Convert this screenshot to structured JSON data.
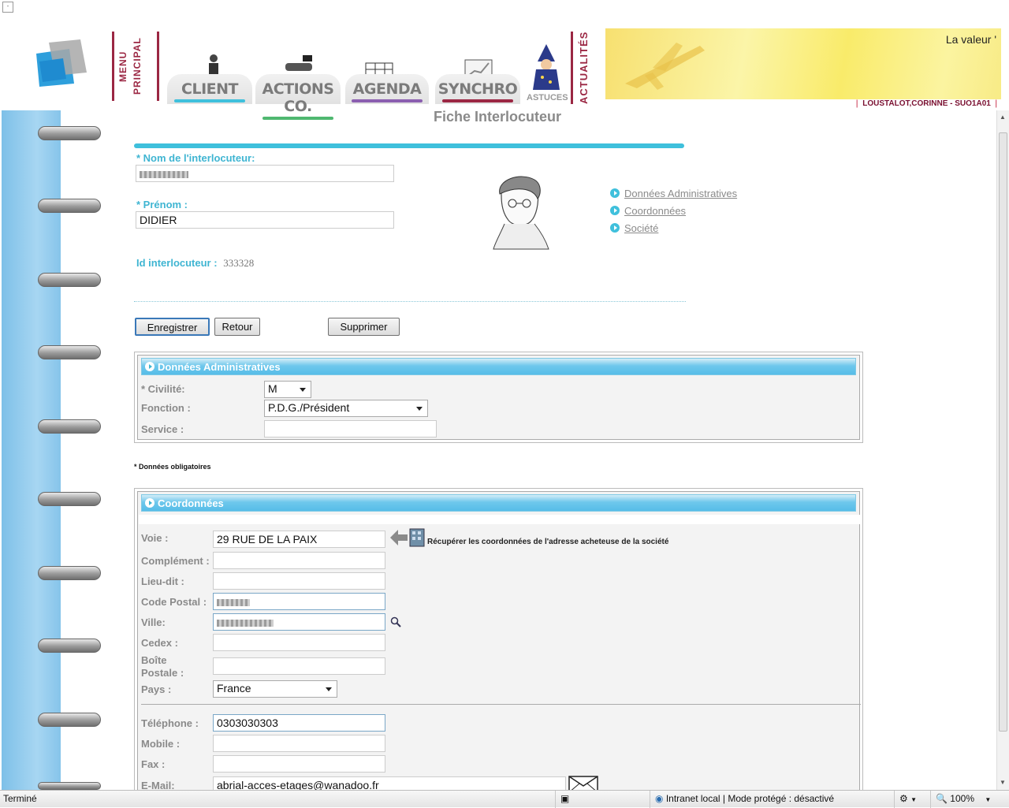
{
  "window": {
    "corner_glyph": "-"
  },
  "nav": {
    "menu_principal": [
      "MENU",
      "PRINCIPAL"
    ],
    "tabs": [
      {
        "label": "CLIENT",
        "color": "#7b7b7b",
        "underline": "#3fc0dc"
      },
      {
        "label": "ACTIONS CO.",
        "color": "#7b7b7b",
        "underline": "#4fb870"
      },
      {
        "label": "AGENDA",
        "color": "#7b7b7b",
        "underline": "#8b5fb0"
      },
      {
        "label": "SYNCHRO",
        "color": "#7b7b7b",
        "underline": "#9b2743"
      }
    ],
    "astuces": "ASTUCES",
    "actualites": "ACTUALITÉS"
  },
  "banner": {
    "text": "La valeur '"
  },
  "user": {
    "line": "LOUSTALOT,CORINNE - SUO1A01"
  },
  "page": {
    "title": "Fiche Interlocuteur",
    "nom_label": "* Nom de l'interlocuteur:",
    "prenom_label": "* Prénom :",
    "prenom_value": "DIDIER",
    "id_label": "Id interlocuteur :",
    "id_value": "333328",
    "links": [
      "Données Administratives",
      "Coordonnées",
      "Société"
    ],
    "buttons": {
      "save": "Enregistrer",
      "back": "Retour",
      "delete": "Supprimer"
    },
    "mandatory_note": "* Données obligatoires"
  },
  "admin": {
    "header": "Données Administratives",
    "civilite_label": "* Civilité:",
    "civilite_value": "M",
    "fonction_label": "Fonction :",
    "fonction_value": "P.D.G./Président",
    "service_label": "Service :"
  },
  "coords": {
    "header": "Coordonnées",
    "voie_label": "Voie :",
    "voie_value": "29 RUE DE LA PAIX",
    "recup_text": "Récupérer les coordonnées de l'adresse acheteuse de la société",
    "complement_label": "Complément :",
    "lieudit_label": "Lieu-dit :",
    "cp_label": "Code Postal :",
    "ville_label": "Ville:",
    "cedex_label": "Cedex :",
    "boite_label_1": "Boîte",
    "boite_label_2": "Postale :",
    "pays_label": "Pays :",
    "pays_value": "France",
    "tel_label": "Téléphone :",
    "tel_value": "0303030303",
    "mobile_label": "Mobile :",
    "fax_label": "Fax :",
    "email_label": "E-Mail:",
    "email_value": "abrial-acces-etages@wanadoo.fr"
  },
  "status": {
    "left": "Terminé",
    "zone": "Intranet local | Mode protégé : désactivé",
    "zoom": "100%"
  }
}
